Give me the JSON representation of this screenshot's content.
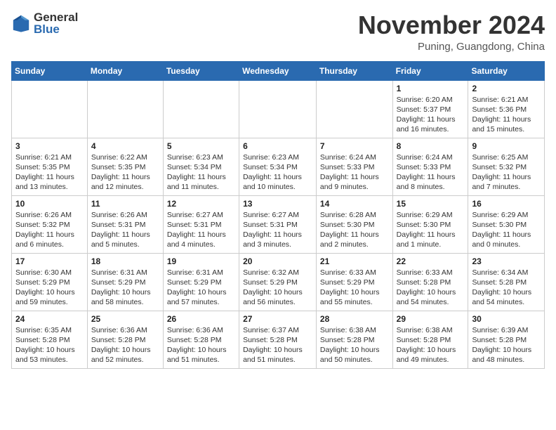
{
  "logo": {
    "general": "General",
    "blue": "Blue"
  },
  "title": "November 2024",
  "location": "Puning, Guangdong, China",
  "weekdays": [
    "Sunday",
    "Monday",
    "Tuesday",
    "Wednesday",
    "Thursday",
    "Friday",
    "Saturday"
  ],
  "weeks": [
    [
      {
        "day": "",
        "info": ""
      },
      {
        "day": "",
        "info": ""
      },
      {
        "day": "",
        "info": ""
      },
      {
        "day": "",
        "info": ""
      },
      {
        "day": "",
        "info": ""
      },
      {
        "day": "1",
        "info": "Sunrise: 6:20 AM\nSunset: 5:37 PM\nDaylight: 11 hours\nand 16 minutes."
      },
      {
        "day": "2",
        "info": "Sunrise: 6:21 AM\nSunset: 5:36 PM\nDaylight: 11 hours\nand 15 minutes."
      }
    ],
    [
      {
        "day": "3",
        "info": "Sunrise: 6:21 AM\nSunset: 5:35 PM\nDaylight: 11 hours\nand 13 minutes."
      },
      {
        "day": "4",
        "info": "Sunrise: 6:22 AM\nSunset: 5:35 PM\nDaylight: 11 hours\nand 12 minutes."
      },
      {
        "day": "5",
        "info": "Sunrise: 6:23 AM\nSunset: 5:34 PM\nDaylight: 11 hours\nand 11 minutes."
      },
      {
        "day": "6",
        "info": "Sunrise: 6:23 AM\nSunset: 5:34 PM\nDaylight: 11 hours\nand 10 minutes."
      },
      {
        "day": "7",
        "info": "Sunrise: 6:24 AM\nSunset: 5:33 PM\nDaylight: 11 hours\nand 9 minutes."
      },
      {
        "day": "8",
        "info": "Sunrise: 6:24 AM\nSunset: 5:33 PM\nDaylight: 11 hours\nand 8 minutes."
      },
      {
        "day": "9",
        "info": "Sunrise: 6:25 AM\nSunset: 5:32 PM\nDaylight: 11 hours\nand 7 minutes."
      }
    ],
    [
      {
        "day": "10",
        "info": "Sunrise: 6:26 AM\nSunset: 5:32 PM\nDaylight: 11 hours\nand 6 minutes."
      },
      {
        "day": "11",
        "info": "Sunrise: 6:26 AM\nSunset: 5:31 PM\nDaylight: 11 hours\nand 5 minutes."
      },
      {
        "day": "12",
        "info": "Sunrise: 6:27 AM\nSunset: 5:31 PM\nDaylight: 11 hours\nand 4 minutes."
      },
      {
        "day": "13",
        "info": "Sunrise: 6:27 AM\nSunset: 5:31 PM\nDaylight: 11 hours\nand 3 minutes."
      },
      {
        "day": "14",
        "info": "Sunrise: 6:28 AM\nSunset: 5:30 PM\nDaylight: 11 hours\nand 2 minutes."
      },
      {
        "day": "15",
        "info": "Sunrise: 6:29 AM\nSunset: 5:30 PM\nDaylight: 11 hours\nand 1 minute."
      },
      {
        "day": "16",
        "info": "Sunrise: 6:29 AM\nSunset: 5:30 PM\nDaylight: 11 hours\nand 0 minutes."
      }
    ],
    [
      {
        "day": "17",
        "info": "Sunrise: 6:30 AM\nSunset: 5:29 PM\nDaylight: 10 hours\nand 59 minutes."
      },
      {
        "day": "18",
        "info": "Sunrise: 6:31 AM\nSunset: 5:29 PM\nDaylight: 10 hours\nand 58 minutes."
      },
      {
        "day": "19",
        "info": "Sunrise: 6:31 AM\nSunset: 5:29 PM\nDaylight: 10 hours\nand 57 minutes."
      },
      {
        "day": "20",
        "info": "Sunrise: 6:32 AM\nSunset: 5:29 PM\nDaylight: 10 hours\nand 56 minutes."
      },
      {
        "day": "21",
        "info": "Sunrise: 6:33 AM\nSunset: 5:29 PM\nDaylight: 10 hours\nand 55 minutes."
      },
      {
        "day": "22",
        "info": "Sunrise: 6:33 AM\nSunset: 5:28 PM\nDaylight: 10 hours\nand 54 minutes."
      },
      {
        "day": "23",
        "info": "Sunrise: 6:34 AM\nSunset: 5:28 PM\nDaylight: 10 hours\nand 54 minutes."
      }
    ],
    [
      {
        "day": "24",
        "info": "Sunrise: 6:35 AM\nSunset: 5:28 PM\nDaylight: 10 hours\nand 53 minutes."
      },
      {
        "day": "25",
        "info": "Sunrise: 6:36 AM\nSunset: 5:28 PM\nDaylight: 10 hours\nand 52 minutes."
      },
      {
        "day": "26",
        "info": "Sunrise: 6:36 AM\nSunset: 5:28 PM\nDaylight: 10 hours\nand 51 minutes."
      },
      {
        "day": "27",
        "info": "Sunrise: 6:37 AM\nSunset: 5:28 PM\nDaylight: 10 hours\nand 51 minutes."
      },
      {
        "day": "28",
        "info": "Sunrise: 6:38 AM\nSunset: 5:28 PM\nDaylight: 10 hours\nand 50 minutes."
      },
      {
        "day": "29",
        "info": "Sunrise: 6:38 AM\nSunset: 5:28 PM\nDaylight: 10 hours\nand 49 minutes."
      },
      {
        "day": "30",
        "info": "Sunrise: 6:39 AM\nSunset: 5:28 PM\nDaylight: 10 hours\nand 48 minutes."
      }
    ]
  ]
}
